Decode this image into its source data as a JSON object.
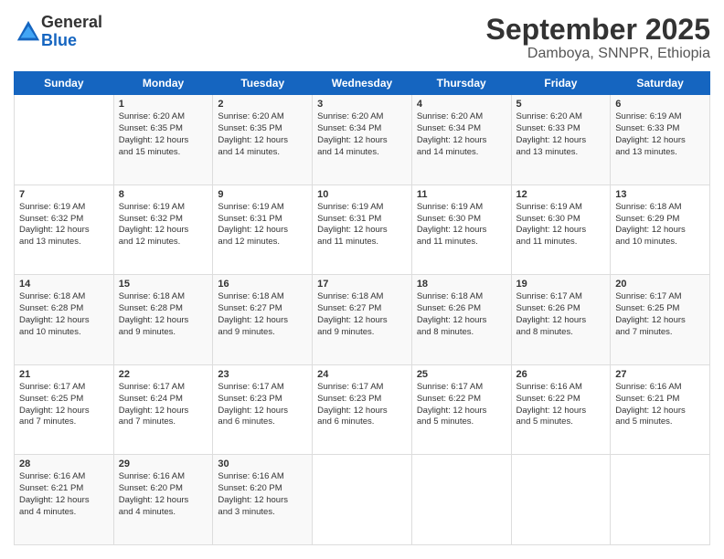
{
  "logo": {
    "general": "General",
    "blue": "Blue"
  },
  "header": {
    "month_year": "September 2025",
    "location": "Damboya, SNNPR, Ethiopia"
  },
  "days_of_week": [
    "Sunday",
    "Monday",
    "Tuesday",
    "Wednesday",
    "Thursday",
    "Friday",
    "Saturday"
  ],
  "weeks": [
    [
      {
        "day": "",
        "content": ""
      },
      {
        "day": "1",
        "content": "Sunrise: 6:20 AM\nSunset: 6:35 PM\nDaylight: 12 hours\nand 15 minutes."
      },
      {
        "day": "2",
        "content": "Sunrise: 6:20 AM\nSunset: 6:35 PM\nDaylight: 12 hours\nand 14 minutes."
      },
      {
        "day": "3",
        "content": "Sunrise: 6:20 AM\nSunset: 6:34 PM\nDaylight: 12 hours\nand 14 minutes."
      },
      {
        "day": "4",
        "content": "Sunrise: 6:20 AM\nSunset: 6:34 PM\nDaylight: 12 hours\nand 14 minutes."
      },
      {
        "day": "5",
        "content": "Sunrise: 6:20 AM\nSunset: 6:33 PM\nDaylight: 12 hours\nand 13 minutes."
      },
      {
        "day": "6",
        "content": "Sunrise: 6:19 AM\nSunset: 6:33 PM\nDaylight: 12 hours\nand 13 minutes."
      }
    ],
    [
      {
        "day": "7",
        "content": "Sunrise: 6:19 AM\nSunset: 6:32 PM\nDaylight: 12 hours\nand 13 minutes."
      },
      {
        "day": "8",
        "content": "Sunrise: 6:19 AM\nSunset: 6:32 PM\nDaylight: 12 hours\nand 12 minutes."
      },
      {
        "day": "9",
        "content": "Sunrise: 6:19 AM\nSunset: 6:31 PM\nDaylight: 12 hours\nand 12 minutes."
      },
      {
        "day": "10",
        "content": "Sunrise: 6:19 AM\nSunset: 6:31 PM\nDaylight: 12 hours\nand 11 minutes."
      },
      {
        "day": "11",
        "content": "Sunrise: 6:19 AM\nSunset: 6:30 PM\nDaylight: 12 hours\nand 11 minutes."
      },
      {
        "day": "12",
        "content": "Sunrise: 6:19 AM\nSunset: 6:30 PM\nDaylight: 12 hours\nand 11 minutes."
      },
      {
        "day": "13",
        "content": "Sunrise: 6:18 AM\nSunset: 6:29 PM\nDaylight: 12 hours\nand 10 minutes."
      }
    ],
    [
      {
        "day": "14",
        "content": "Sunrise: 6:18 AM\nSunset: 6:28 PM\nDaylight: 12 hours\nand 10 minutes."
      },
      {
        "day": "15",
        "content": "Sunrise: 6:18 AM\nSunset: 6:28 PM\nDaylight: 12 hours\nand 9 minutes."
      },
      {
        "day": "16",
        "content": "Sunrise: 6:18 AM\nSunset: 6:27 PM\nDaylight: 12 hours\nand 9 minutes."
      },
      {
        "day": "17",
        "content": "Sunrise: 6:18 AM\nSunset: 6:27 PM\nDaylight: 12 hours\nand 9 minutes."
      },
      {
        "day": "18",
        "content": "Sunrise: 6:18 AM\nSunset: 6:26 PM\nDaylight: 12 hours\nand 8 minutes."
      },
      {
        "day": "19",
        "content": "Sunrise: 6:17 AM\nSunset: 6:26 PM\nDaylight: 12 hours\nand 8 minutes."
      },
      {
        "day": "20",
        "content": "Sunrise: 6:17 AM\nSunset: 6:25 PM\nDaylight: 12 hours\nand 7 minutes."
      }
    ],
    [
      {
        "day": "21",
        "content": "Sunrise: 6:17 AM\nSunset: 6:25 PM\nDaylight: 12 hours\nand 7 minutes."
      },
      {
        "day": "22",
        "content": "Sunrise: 6:17 AM\nSunset: 6:24 PM\nDaylight: 12 hours\nand 7 minutes."
      },
      {
        "day": "23",
        "content": "Sunrise: 6:17 AM\nSunset: 6:23 PM\nDaylight: 12 hours\nand 6 minutes."
      },
      {
        "day": "24",
        "content": "Sunrise: 6:17 AM\nSunset: 6:23 PM\nDaylight: 12 hours\nand 6 minutes."
      },
      {
        "day": "25",
        "content": "Sunrise: 6:17 AM\nSunset: 6:22 PM\nDaylight: 12 hours\nand 5 minutes."
      },
      {
        "day": "26",
        "content": "Sunrise: 6:16 AM\nSunset: 6:22 PM\nDaylight: 12 hours\nand 5 minutes."
      },
      {
        "day": "27",
        "content": "Sunrise: 6:16 AM\nSunset: 6:21 PM\nDaylight: 12 hours\nand 5 minutes."
      }
    ],
    [
      {
        "day": "28",
        "content": "Sunrise: 6:16 AM\nSunset: 6:21 PM\nDaylight: 12 hours\nand 4 minutes."
      },
      {
        "day": "29",
        "content": "Sunrise: 6:16 AM\nSunset: 6:20 PM\nDaylight: 12 hours\nand 4 minutes."
      },
      {
        "day": "30",
        "content": "Sunrise: 6:16 AM\nSunset: 6:20 PM\nDaylight: 12 hours\nand 3 minutes."
      },
      {
        "day": "",
        "content": ""
      },
      {
        "day": "",
        "content": ""
      },
      {
        "day": "",
        "content": ""
      },
      {
        "day": "",
        "content": ""
      }
    ]
  ]
}
